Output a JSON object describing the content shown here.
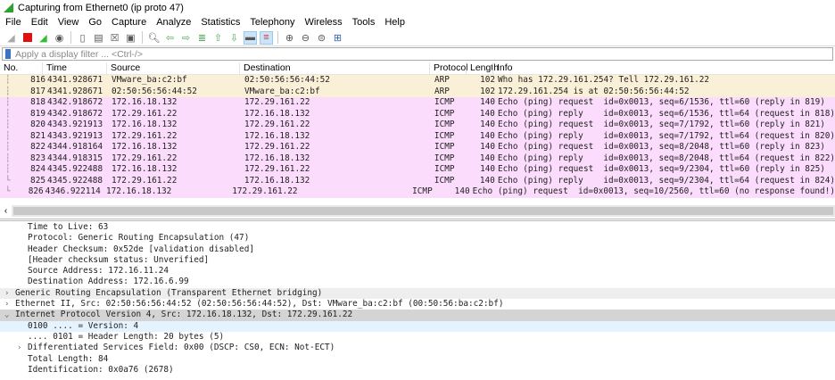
{
  "window": {
    "title": "Capturing from Ethernet0 (ip proto 47)"
  },
  "menu": [
    "File",
    "Edit",
    "View",
    "Go",
    "Capture",
    "Analyze",
    "Statistics",
    "Telephony",
    "Wireless",
    "Tools",
    "Help"
  ],
  "filter": {
    "placeholder": "Apply a display filter ... <Ctrl-/>"
  },
  "columns": [
    "No.",
    "Time",
    "Source",
    "Destination",
    "Protocol",
    "Length",
    "Info"
  ],
  "packets": [
    {
      "no": "816",
      "time": "4341.928671",
      "src": "VMware_ba:c2:bf",
      "dst": "02:50:56:56:44:52",
      "proto": "ARP",
      "len": "102",
      "info": "Who has 172.29.161.254? Tell 172.29.161.22"
    },
    {
      "no": "817",
      "time": "4341.928671",
      "src": "02:50:56:56:44:52",
      "dst": "VMware_ba:c2:bf",
      "proto": "ARP",
      "len": "102",
      "info": "172.29.161.254 is at 02:50:56:56:44:52"
    },
    {
      "no": "818",
      "time": "4342.918672",
      "src": "172.16.18.132",
      "dst": "172.29.161.22",
      "proto": "ICMP",
      "len": "140",
      "info": "Echo (ping) request  id=0x0013, seq=6/1536, ttl=60 (reply in 819)"
    },
    {
      "no": "819",
      "time": "4342.918672",
      "src": "172.29.161.22",
      "dst": "172.16.18.132",
      "proto": "ICMP",
      "len": "140",
      "info": "Echo (ping) reply    id=0x0013, seq=6/1536, ttl=64 (request in 818)"
    },
    {
      "no": "820",
      "time": "4343.921913",
      "src": "172.16.18.132",
      "dst": "172.29.161.22",
      "proto": "ICMP",
      "len": "140",
      "info": "Echo (ping) request  id=0x0013, seq=7/1792, ttl=60 (reply in 821)"
    },
    {
      "no": "821",
      "time": "4343.921913",
      "src": "172.29.161.22",
      "dst": "172.16.18.132",
      "proto": "ICMP",
      "len": "140",
      "info": "Echo (ping) reply    id=0x0013, seq=7/1792, ttl=64 (request in 820)"
    },
    {
      "no": "822",
      "time": "4344.918164",
      "src": "172.16.18.132",
      "dst": "172.29.161.22",
      "proto": "ICMP",
      "len": "140",
      "info": "Echo (ping) request  id=0x0013, seq=8/2048, ttl=60 (reply in 823)"
    },
    {
      "no": "823",
      "time": "4344.918315",
      "src": "172.29.161.22",
      "dst": "172.16.18.132",
      "proto": "ICMP",
      "len": "140",
      "info": "Echo (ping) reply    id=0x0013, seq=8/2048, ttl=64 (request in 822)"
    },
    {
      "no": "824",
      "time": "4345.922488",
      "src": "172.16.18.132",
      "dst": "172.29.161.22",
      "proto": "ICMP",
      "len": "140",
      "info": "Echo (ping) request  id=0x0013, seq=9/2304, ttl=60 (reply in 825)"
    },
    {
      "no": "825",
      "time": "4345.922488",
      "src": "172.29.161.22",
      "dst": "172.16.18.132",
      "proto": "ICMP",
      "len": "140",
      "info": "Echo (ping) reply    id=0x0013, seq=9/2304, ttl=64 (request in 824)"
    },
    {
      "no": "826",
      "time": "4346.922114",
      "src": "172.16.18.132",
      "dst": "172.29.161.22",
      "proto": "ICMP",
      "len": "140",
      "info": "Echo (ping) request  id=0x0013, seq=10/2560, ttl=60 (no response found!)"
    }
  ],
  "details": [
    {
      "text": "Time to Live: 63",
      "level": 1,
      "style": ""
    },
    {
      "text": "Protocol: Generic Routing Encapsulation (47)",
      "level": 1,
      "style": ""
    },
    {
      "text": "Header Checksum: 0x52de [validation disabled]",
      "level": 1,
      "style": ""
    },
    {
      "text": "[Header checksum status: Unverified]",
      "level": 1,
      "style": ""
    },
    {
      "text": "Source Address: 172.16.11.24",
      "level": 1,
      "style": ""
    },
    {
      "text": "Destination Address: 172.16.6.99",
      "level": 1,
      "style": ""
    },
    {
      "text": "Generic Routing Encapsulation (Transparent Ethernet bridging)",
      "level": 0,
      "style": "gray",
      "arrow": ">"
    },
    {
      "text": "Ethernet II, Src: 02:50:56:56:44:52 (02:50:56:56:44:52), Dst: VMware_ba:c2:bf (00:50:56:ba:c2:bf)",
      "level": 0,
      "style": "",
      "arrow": ">"
    },
    {
      "text": "Internet Protocol Version 4, Src: 172.16.18.132, Dst: 172.29.161.22",
      "level": 0,
      "style": "sel",
      "arrow": "v"
    },
    {
      "text": "0100 .... = Version: 4",
      "level": 1,
      "style": "hl"
    },
    {
      "text": ".... 0101 = Header Length: 20 bytes (5)",
      "level": 1,
      "style": ""
    },
    {
      "text": "Differentiated Services Field: 0x00 (DSCP: CS0, ECN: Not-ECT)",
      "level": 1,
      "style": "",
      "arrow": ">"
    },
    {
      "text": "Total Length: 84",
      "level": 1,
      "style": ""
    },
    {
      "text": "Identification: 0x0a76 (2678)",
      "level": 1,
      "style": ""
    }
  ]
}
